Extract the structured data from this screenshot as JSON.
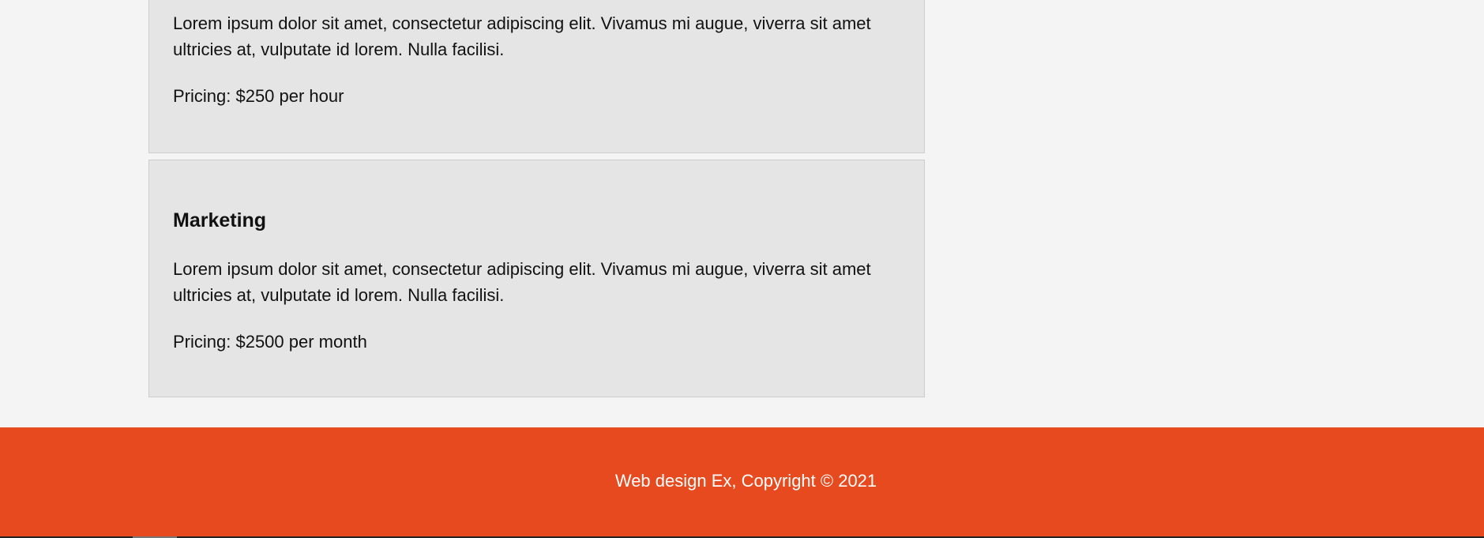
{
  "services": [
    {
      "title": "",
      "description": "Lorem ipsum dolor sit amet, consectetur adipiscing elit. Vivamus mi augue, viverra sit amet ultricies at, vulputate id lorem. Nulla facilisi.",
      "pricing": "Pricing: $250 per hour"
    },
    {
      "title": "Marketing",
      "description": "Lorem ipsum dolor sit amet, consectetur adipiscing elit. Vivamus mi augue, viverra sit amet ultricies at, vulputate id lorem. Nulla facilisi.",
      "pricing": "Pricing: $2500 per month"
    }
  ],
  "footer": {
    "text": "Web design Ex, Copyright © 2021"
  },
  "colors": {
    "background": "#f4f4f4",
    "card": "#e5e5e5",
    "card_border": "#cccccc",
    "footer": "#e84a1f",
    "footer_text": "#ffffff"
  }
}
